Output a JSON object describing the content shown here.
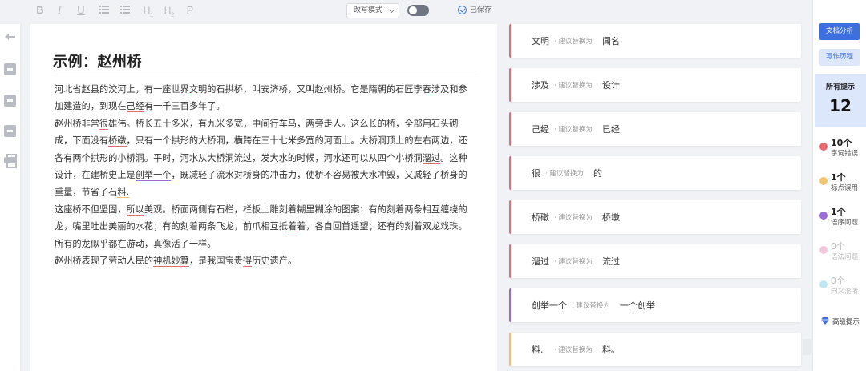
{
  "toolbar": {
    "bold": "B",
    "italic": "I",
    "underline": "U",
    "heading1": "H",
    "heading2": "H",
    "paragraph": "P",
    "mode_select": "改写模式",
    "saved": "已保存"
  },
  "editor": {
    "title": "示例：赵州桥",
    "paragraphs": [
      [
        {
          "t": "河北省赵县的洨河上，有一座世界"
        },
        {
          "t": "文明",
          "e": "red"
        },
        {
          "t": "的石拱桥，叫安济桥，又叫赵州桥。它是隋朝的石匠李春"
        },
        {
          "t": "涉及",
          "e": "red"
        },
        {
          "t": "和参加建造的，到现在"
        },
        {
          "t": "己经",
          "e": "red"
        },
        {
          "t": "有一千三百多年了。"
        }
      ],
      [
        {
          "t": "赵州桥非常"
        },
        {
          "t": "很",
          "e": "red"
        },
        {
          "t": "雄伟。桥长五十多米，有九米多宽，中间行车马，两旁走人。这么长的桥，全部用石头砌成，下面没有"
        },
        {
          "t": "桥礅",
          "e": "red"
        },
        {
          "t": "，只有一个拱形的大桥洞，横跨在三十七米多宽的河面上。大桥洞顶上的左右两边，还各有两个拱形的小桥洞。平时，河水从大桥洞流过，发大水的时候，河水还可以从四个小桥洞"
        },
        {
          "t": "溜过",
          "e": "red"
        },
        {
          "t": "。这种设计，在建桥史上是"
        },
        {
          "t": "创举一个",
          "e": "purple"
        },
        {
          "t": "，既减轻了流水对桥身的冲击力，使桥不容易被大水冲毁，又减轻了桥身的重量，节省了石"
        },
        {
          "t": "料.",
          "e": "yellow"
        }
      ],
      [
        {
          "t": "这座桥不但坚固，"
        },
        {
          "t": "所以",
          "e": "red"
        },
        {
          "t": "美观。桥面两侧有石栏，栏板上雕刻着糊里糊涂的图案：有的刻着两条相互缠绕的龙，嘴里吐出美丽的水花；有的刻着两条飞龙，前爪相互抵"
        },
        {
          "t": "着",
          "e": "red"
        },
        {
          "t": "着，各自回首遥望；还有的刻着双龙戏珠。所有的龙似乎都在游动，真像活了一样。"
        }
      ],
      [
        {
          "t": "赵州桥表现了劳动人民的"
        },
        {
          "t": "神机妙算",
          "e": "red"
        },
        {
          "t": "，是我国宝贵"
        },
        {
          "t": "得",
          "e": "red"
        },
        {
          "t": "历史遗产。"
        }
      ]
    ]
  },
  "suggestions": {
    "hint": "· 建议替换为",
    "items": [
      {
        "original": "文明",
        "replacement": "闻名",
        "type": "red"
      },
      {
        "original": "涉及",
        "replacement": "设计",
        "type": "red"
      },
      {
        "original": "己经",
        "replacement": "已经",
        "type": "red"
      },
      {
        "original": "很",
        "replacement": "的",
        "type": "red"
      },
      {
        "original": "桥礅",
        "replacement": "桥墩",
        "type": "red"
      },
      {
        "original": "溜过",
        "replacement": "流过",
        "type": "red"
      },
      {
        "original": "创举一个",
        "replacement": "一个创举",
        "type": "purple"
      },
      {
        "original": "料.",
        "replacement": "料。",
        "type": "yellow"
      }
    ]
  },
  "panel": {
    "analysis_button": "文档分析",
    "history_button": "写作历程",
    "total_label": "所有提示",
    "total_count": "12",
    "categories": [
      {
        "count": "10个",
        "label": "字词错误",
        "color": "#e8686e",
        "dim": false
      },
      {
        "count": "1个",
        "label": "标点误用",
        "color": "#f2c46c",
        "dim": false
      },
      {
        "count": "1个",
        "label": "语序问题",
        "color": "#9b6dd8",
        "dim": false
      },
      {
        "count": "0个",
        "label": "语法问题",
        "color": "#f7c8dc",
        "dim": true
      },
      {
        "count": "0个",
        "label": "同义混淆",
        "color": "#bfe6f5",
        "dim": true
      }
    ],
    "advanced": "高级提示"
  },
  "colors": {
    "accent": "#3e6fe0",
    "error_red": "#e36b70",
    "error_purple": "#9b6fd6",
    "error_yellow": "#f0c36b"
  }
}
